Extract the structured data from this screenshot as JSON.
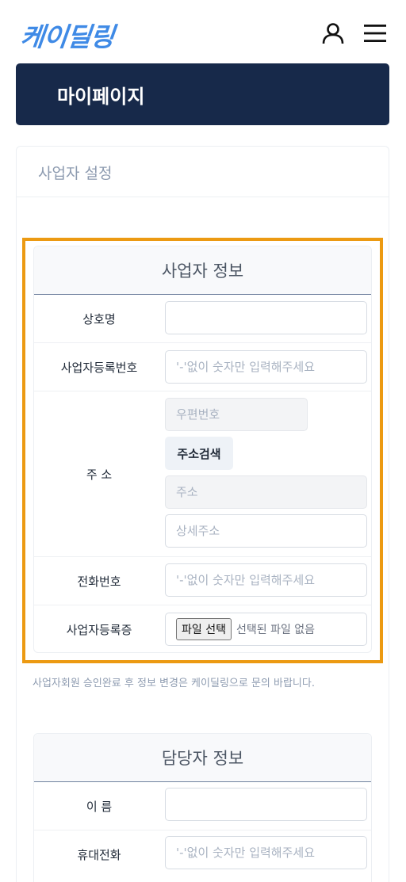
{
  "header": {
    "logo_text": "케이딜링",
    "user_icon": "user-icon",
    "menu_icon": "hamburger-menu-icon"
  },
  "banner": {
    "title": "마이페이지"
  },
  "settings": {
    "title": "사업자 설정"
  },
  "business_info": {
    "title": "사업자 정보",
    "company_name": {
      "label": "상호명",
      "value": "",
      "placeholder": ""
    },
    "reg_number": {
      "label": "사업자등록번호",
      "value": "",
      "placeholder": "'-'없이 숫자만 입력해주세요"
    },
    "address": {
      "label": "주 소",
      "postcode_placeholder": "우편번호",
      "search_button": "주소검색",
      "address_placeholder": "주소",
      "detail_placeholder": "상세주소"
    },
    "phone": {
      "label": "전화번호",
      "value": "",
      "placeholder": "'-'없이 숫자만 입력해주세요"
    },
    "certificate": {
      "label": "사업자등록증",
      "button": "파일 선택",
      "status": "선택된 파일 없음"
    }
  },
  "note": "사업자회원 승인완료 후 정보 변경은 케이딜링으로 문의 바랍니다.",
  "manager_info": {
    "title": "담당자 정보",
    "name": {
      "label": "이 름",
      "value": "",
      "placeholder": ""
    },
    "mobile": {
      "label": "휴대전화",
      "value": "",
      "placeholder": "'-'없이 숫자만 입력해주세요"
    }
  },
  "colors": {
    "brand": "#3f8ae6",
    "banner_bg": "#17294a",
    "highlight": "#ec9a12"
  }
}
